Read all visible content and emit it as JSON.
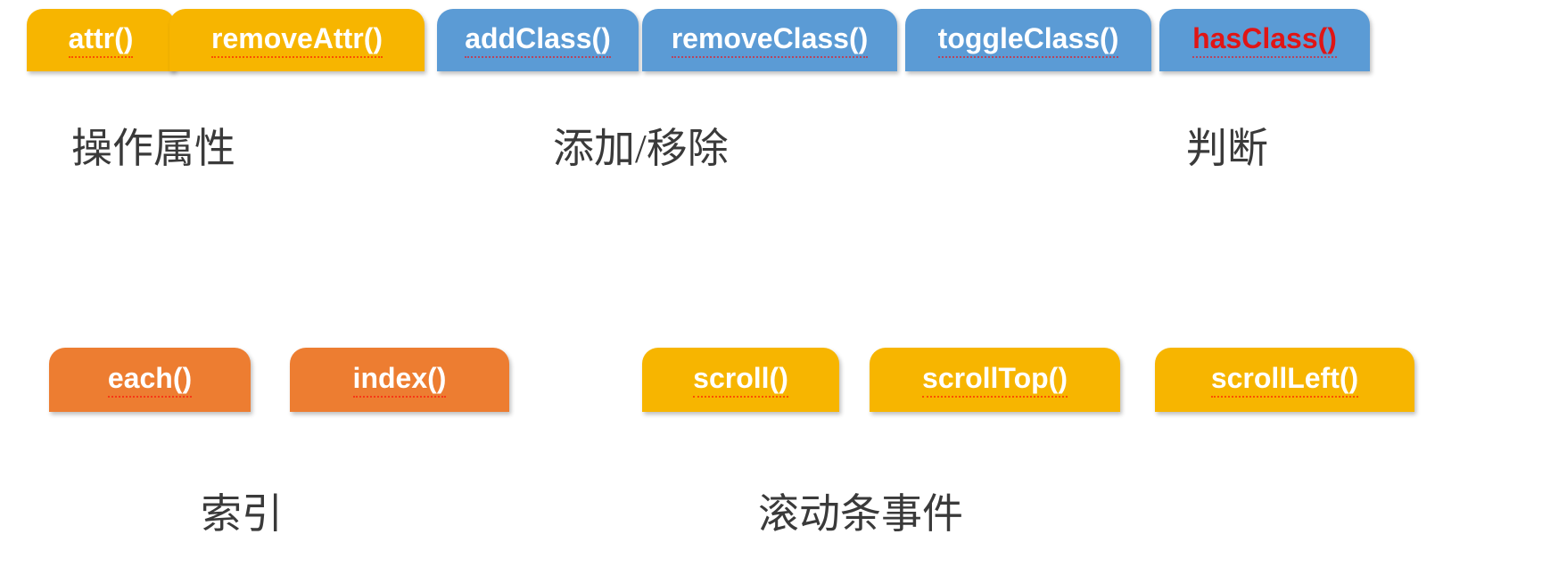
{
  "groups": {
    "attr": {
      "caption": "操作属性",
      "items": [
        "attr()",
        "removeAttr()"
      ]
    },
    "class": {
      "caption": "添加/移除",
      "items": [
        "addClass()",
        "removeClass()",
        "toggleClass()"
      ]
    },
    "hasclass": {
      "caption": "判断",
      "items": [
        "hasClass()"
      ]
    },
    "index": {
      "caption": "索引",
      "items": [
        "each()",
        "index()"
      ]
    },
    "scroll": {
      "caption": "滚动条事件",
      "items": [
        "scroll()",
        "scrollTop()",
        "scrollLeft()"
      ]
    }
  }
}
